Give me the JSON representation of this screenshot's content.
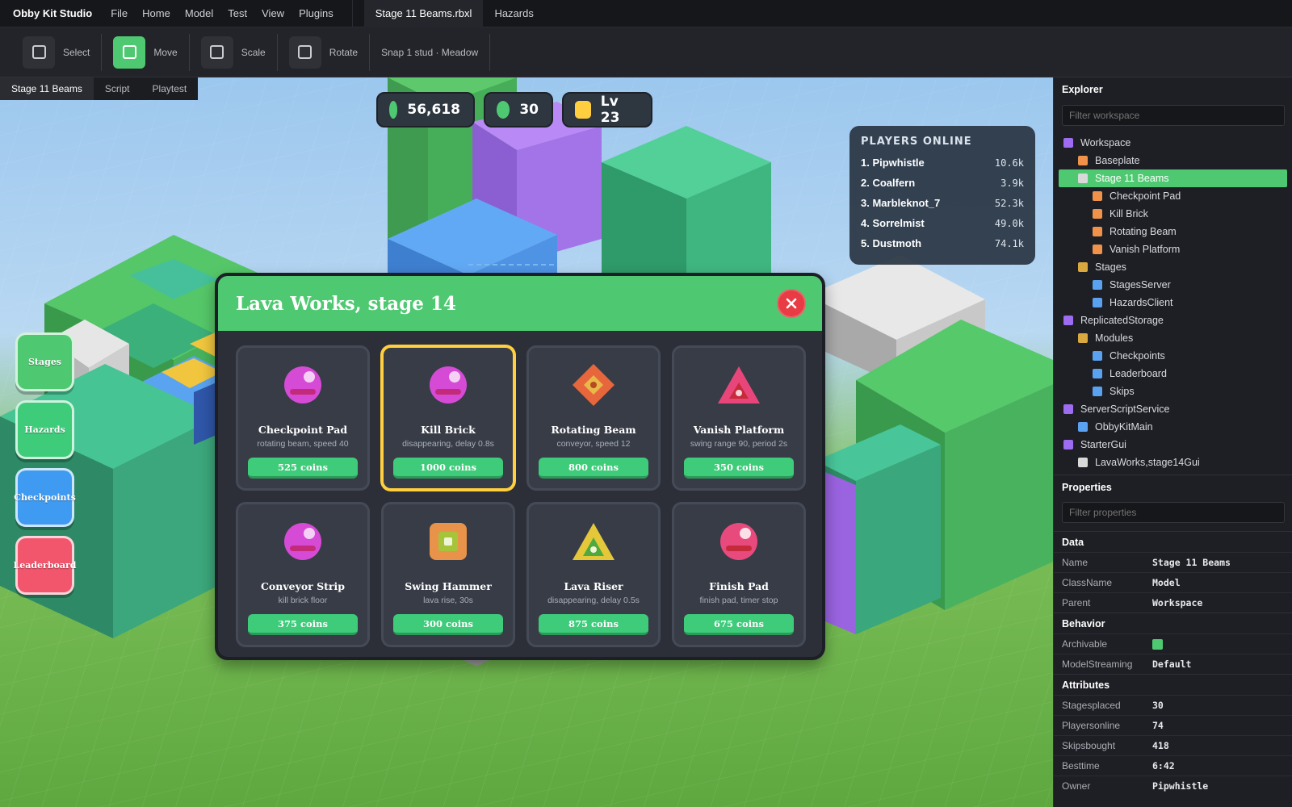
{
  "menubar": {
    "brand": "Obby Kit Studio",
    "menus": [
      "File",
      "Home",
      "Model",
      "Test",
      "View",
      "Plugins"
    ],
    "active_file": "Stage 11 Beams.rbxl",
    "other_file": "Hazards"
  },
  "toolbar": {
    "tools": [
      "Select",
      "Move",
      "Scale",
      "Rotate"
    ],
    "active_tool": "Move",
    "snap": "Snap 1 stud · Meadow"
  },
  "viewport_tabs": {
    "tabs": [
      "Stage 11 Beams",
      "Script",
      "Playtest"
    ],
    "active": "Stage 11 Beams"
  },
  "hud": {
    "coins": "56,618",
    "gems": "30",
    "level": "Lv 23"
  },
  "players_online": {
    "title": "PLAYERS ONLINE",
    "rows": [
      {
        "name": "1. Pipwhistle",
        "value": "10.6k"
      },
      {
        "name": "2. Coalfern",
        "value": "3.9k"
      },
      {
        "name": "3. Marbleknot_7",
        "value": "52.3k"
      },
      {
        "name": "4. Sorrelmist",
        "value": "49.0k"
      },
      {
        "name": "5. Dustmoth",
        "value": "74.1k"
      }
    ]
  },
  "side_buttons": [
    {
      "label": "Stages",
      "color": "#4fc971"
    },
    {
      "label": "Hazards",
      "color": "#3ecb7a"
    },
    {
      "label": "Checkpoints",
      "color": "#3f9bf2"
    },
    {
      "label": "Leaderboard",
      "color": "#f1566c"
    }
  ],
  "modal": {
    "title": "Lava Works, stage 14",
    "selected_index": 1,
    "cards": [
      {
        "title": "Checkpoint Pad",
        "desc": "rotating beam, speed 40",
        "price": "525 coins",
        "icon": "pad-icon",
        "color": "#d64bd6"
      },
      {
        "title": "Kill Brick",
        "desc": "disappearing, delay 0.8s",
        "price": "1000 coins",
        "icon": "pad-icon",
        "color": "#d64bd6"
      },
      {
        "title": "Rotating Beam",
        "desc": "conveyor, speed 12",
        "price": "800 coins",
        "icon": "diamond-icon",
        "color": "#e8663c"
      },
      {
        "title": "Vanish Platform",
        "desc": "swing range 90, period 2s",
        "price": "350 coins",
        "icon": "triangle-icon",
        "color": "#e8467a"
      },
      {
        "title": "Conveyor Strip",
        "desc": "kill brick floor",
        "price": "375 coins",
        "icon": "pad-icon",
        "color": "#d64bd6"
      },
      {
        "title": "Swing Hammer",
        "desc": "lava rise, 30s",
        "price": "300 coins",
        "icon": "square-icon",
        "color": "#e8924a"
      },
      {
        "title": "Lava Riser",
        "desc": "disappearing, delay 0.5s",
        "price": "875 coins",
        "icon": "triangle-icon",
        "color": "#e4c83a"
      },
      {
        "title": "Finish Pad",
        "desc": "finish pad, timer stop",
        "price": "675 coins",
        "icon": "pad-icon",
        "color": "#e84a7e"
      }
    ]
  },
  "explorer": {
    "title": "Explorer",
    "filter_placeholder": "Filter workspace",
    "items": [
      {
        "label": "Workspace",
        "depth": 0,
        "color": "#9d6cf0"
      },
      {
        "label": "Baseplate",
        "depth": 1,
        "color": "#f0924a"
      },
      {
        "label": "Stage 11 Beams",
        "depth": 1,
        "color": "#d9d9d9",
        "selected": true
      },
      {
        "label": "Checkpoint Pad",
        "depth": 2,
        "color": "#f0924a"
      },
      {
        "label": "Kill Brick",
        "depth": 2,
        "color": "#f0924a"
      },
      {
        "label": "Rotating Beam",
        "depth": 2,
        "color": "#f0924a"
      },
      {
        "label": "Vanish Platform",
        "depth": 2,
        "color": "#f0924a"
      },
      {
        "label": "Stages",
        "depth": 1,
        "color": "#d9a83e"
      },
      {
        "label": "StagesServer",
        "depth": 2,
        "color": "#5aa2f0"
      },
      {
        "label": "HazardsClient",
        "depth": 2,
        "color": "#5aa2f0"
      },
      {
        "label": "ReplicatedStorage",
        "depth": 0,
        "color": "#9d6cf0"
      },
      {
        "label": "Modules",
        "depth": 1,
        "color": "#d9a83e"
      },
      {
        "label": "Checkpoints",
        "depth": 2,
        "color": "#5aa2f0"
      },
      {
        "label": "Leaderboard",
        "depth": 2,
        "color": "#5aa2f0"
      },
      {
        "label": "Skips",
        "depth": 2,
        "color": "#5aa2f0"
      },
      {
        "label": "ServerScriptService",
        "depth": 0,
        "color": "#9d6cf0"
      },
      {
        "label": "ObbyKitMain",
        "depth": 1,
        "color": "#5aa2f0"
      },
      {
        "label": "StarterGui",
        "depth": 0,
        "color": "#9d6cf0"
      },
      {
        "label": "LavaWorks,stage14Gui",
        "depth": 1,
        "color": "#d9d9d9"
      }
    ]
  },
  "properties": {
    "title": "Properties",
    "filter_placeholder": "Filter properties",
    "sections": [
      {
        "name": "Data",
        "rows": [
          {
            "key": "Name",
            "value": "Stage 11 Beams"
          },
          {
            "key": "ClassName",
            "value": "Model"
          },
          {
            "key": "Parent",
            "value": "Workspace"
          }
        ]
      },
      {
        "name": "Behavior",
        "rows": [
          {
            "key": "Archivable",
            "value": "",
            "checkbox": true
          },
          {
            "key": "ModelStreaming",
            "value": "Default"
          }
        ]
      },
      {
        "name": "Attributes",
        "rows": [
          {
            "key": "Stagesplaced",
            "value": "30"
          },
          {
            "key": "Playersonline",
            "value": "74"
          },
          {
            "key": "Skipsbought",
            "value": "418"
          },
          {
            "key": "Besttime",
            "value": "6:42"
          },
          {
            "key": "Owner",
            "value": "Pipwhistle"
          }
        ]
      }
    ]
  }
}
